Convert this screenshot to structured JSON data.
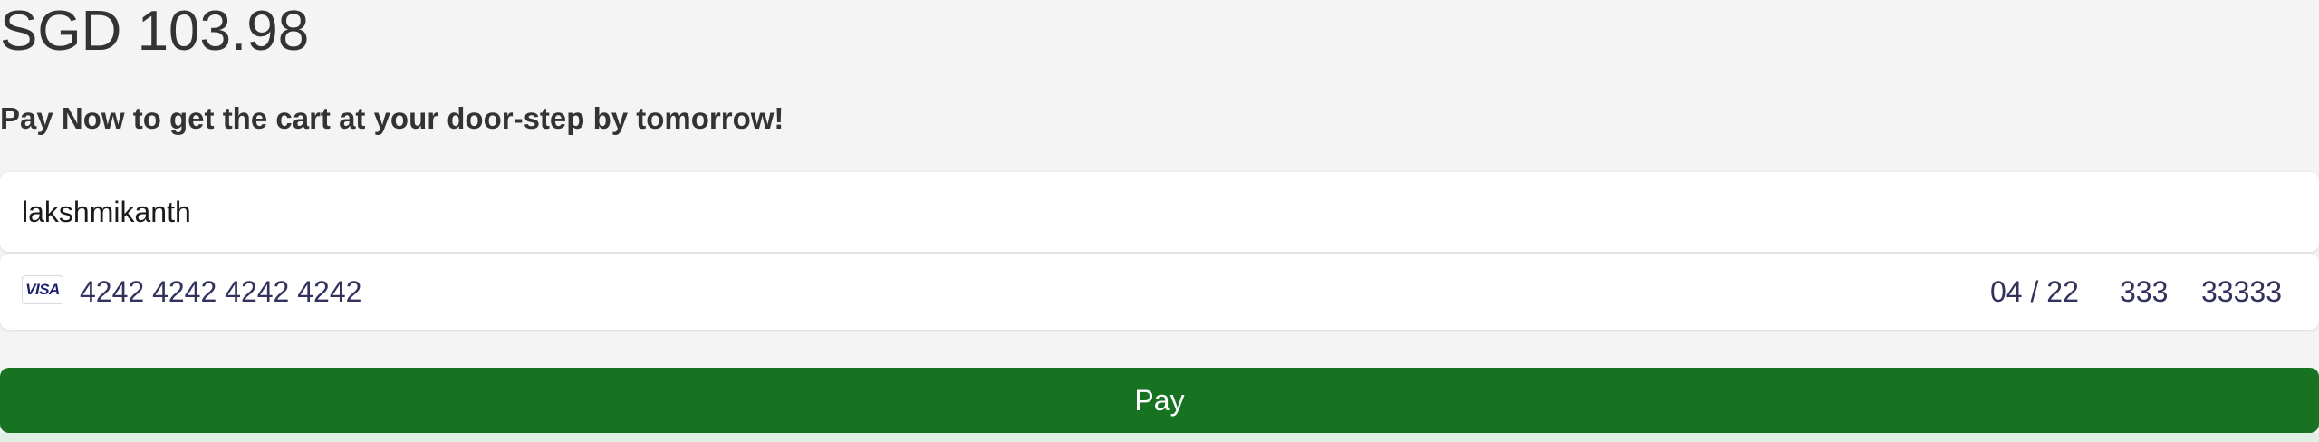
{
  "order": {
    "amount": "SGD 103.98",
    "message": "Pay Now to get the cart at your door-step by tomorrow!"
  },
  "payment_form": {
    "name_value": "lakshmikanth",
    "card": {
      "brand_icon": "visa-icon",
      "brand_text": "VISA",
      "number": "4242 4242 4242 4242",
      "expiry": "04 / 22",
      "cvc": "333",
      "zip": "33333"
    },
    "pay_label": "Pay"
  },
  "colors": {
    "background": "#f4f4f4",
    "pay_button": "#177321",
    "card_text": "#32325d",
    "visa_blue": "#1a1f71"
  }
}
